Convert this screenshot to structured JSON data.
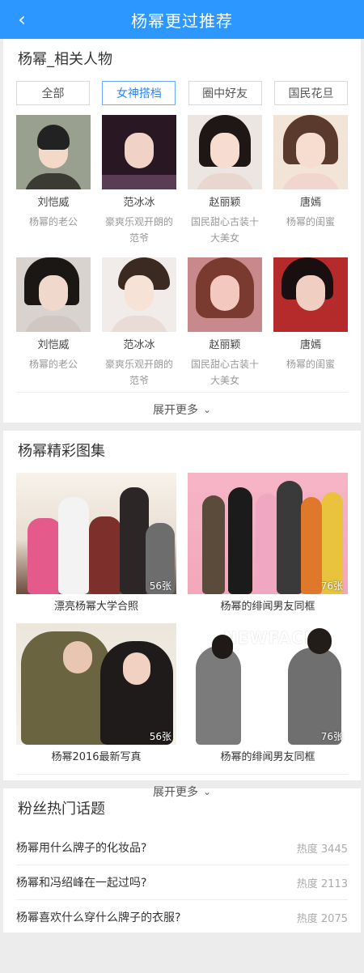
{
  "header": {
    "title": "杨幂更过推荐",
    "back_icon": "chevron-left-icon"
  },
  "related": {
    "title": "杨幂_相关人物",
    "filters": [
      "全部",
      "女神搭档",
      "圈中好友",
      "国民花旦"
    ],
    "active_filter": "女神搭档",
    "people": [
      {
        "name": "刘恺威",
        "desc": "杨幂的老公"
      },
      {
        "name": "范冰冰",
        "desc": "豪爽乐观开朗的范爷"
      },
      {
        "name": "赵丽颖",
        "desc": "国民甜心古装十大美女"
      },
      {
        "name": "唐嫣",
        "desc": "杨幂的闺蜜"
      },
      {
        "name": "刘恺威",
        "desc": "杨幂的老公"
      },
      {
        "name": "范冰冰",
        "desc": "豪爽乐观开朗的范爷"
      },
      {
        "name": "赵丽颖",
        "desc": "国民甜心古装十大美女"
      },
      {
        "name": "唐嫣",
        "desc": "杨幂的闺蜜"
      }
    ],
    "more_label": "展开更多"
  },
  "gallery": {
    "title": "杨幂精彩图集",
    "albums": [
      {
        "count": "56张",
        "caption": "漂亮杨幂大学合照"
      },
      {
        "count": "76张",
        "caption": "杨幂的绯闻男友同框"
      },
      {
        "count": "56张",
        "caption": "杨幂2016最新写真"
      },
      {
        "count": "76张",
        "caption": "杨幂的绯闻男友同框",
        "watermark": "NEWFACE"
      }
    ],
    "more_label": "展开更多"
  },
  "topics": {
    "title": "粉丝热门话题",
    "items": [
      {
        "question": "杨幂用什么牌子的化妆品?",
        "heat": "热度 3445"
      },
      {
        "question": "杨幂和冯绍峰在一起过吗?",
        "heat": "热度 2113"
      },
      {
        "question": "杨幂喜欢什么穿什么牌子的衣服?",
        "heat": "热度 2075"
      }
    ]
  }
}
